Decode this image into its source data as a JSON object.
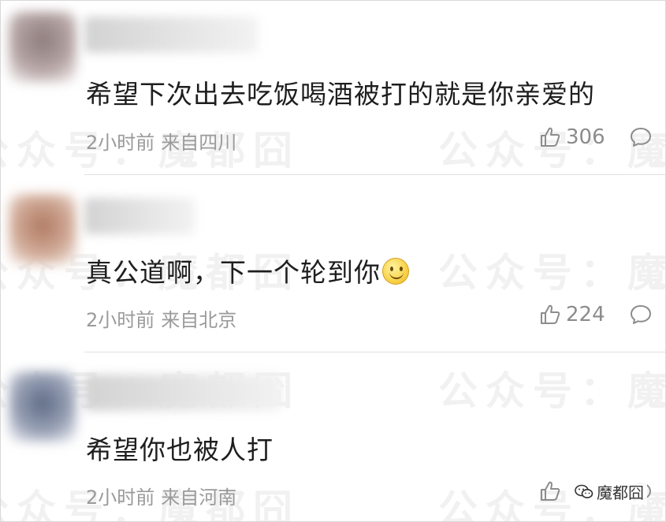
{
  "watermark": "公众号：魔都囧",
  "comments": [
    {
      "content": "希望下次出去吃饭喝酒被打的就是你亲爱的",
      "time": "2小时前",
      "location": "来自四川",
      "likes": "306",
      "avatar_color": "#a89696",
      "emoji": ""
    },
    {
      "content": "真公道啊，下一个轮到你",
      "time": "2小时前",
      "location": "来自北京",
      "likes": "224",
      "avatar_color": "#c79a85",
      "emoji": "smile-emoji"
    },
    {
      "content": "希望你也被人打",
      "time": "2小时前",
      "location": "来自河南",
      "likes": "",
      "avatar_color": "#8089a3",
      "emoji": ""
    }
  ],
  "badge": {
    "label": "魔都囧",
    "icon": "wechat-icon"
  },
  "colors": {
    "meta_gray": "#9a9a9a",
    "divider": "#e2e2e2"
  }
}
